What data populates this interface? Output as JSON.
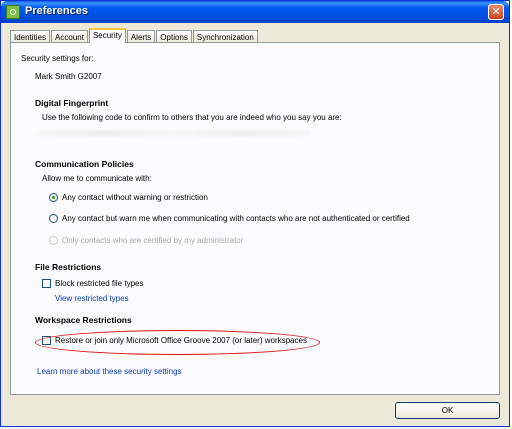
{
  "window": {
    "title": "Preferences",
    "close_glyph": "✕"
  },
  "tabs": [
    {
      "label": "Identities",
      "active": false
    },
    {
      "label": "Account",
      "active": false
    },
    {
      "label": "Security",
      "active": true
    },
    {
      "label": "Alerts",
      "active": false
    },
    {
      "label": "Options",
      "active": false
    },
    {
      "label": "Synchronization",
      "active": false
    }
  ],
  "security": {
    "settings_for_label": "Security settings for:",
    "identity_name": "Mark Smith G2007",
    "fingerprint": {
      "heading": "Digital Fingerprint",
      "description": "Use the following code to confirm to others that you are indeed who you say you are:"
    },
    "communication": {
      "heading": "Communication Policies",
      "allow_label": "Allow me to communicate with:",
      "options": [
        {
          "label": "Any contact without warning or restriction",
          "selected": true,
          "enabled": true
        },
        {
          "label": "Any contact but warn me when communicating with contacts who are not authenticated or certified",
          "selected": false,
          "enabled": true
        },
        {
          "label": "Only contacts who are certified by my administrator",
          "selected": false,
          "enabled": false
        }
      ]
    },
    "file_restrictions": {
      "heading": "File Restrictions",
      "block_label": "Block restricted file types",
      "block_checked": false,
      "view_link": "View restricted types"
    },
    "workspace_restrictions": {
      "heading": "Workspace Restrictions",
      "restore_label": "Restore or join only Microsoft Office Groove 2007 (or later) workspaces",
      "restore_checked": false,
      "highlight_color": "#e01010"
    },
    "learn_more_link": "Learn more about these security settings"
  },
  "footer": {
    "ok_label": "OK"
  },
  "colors": {
    "titlebar": "#0058ee",
    "link": "#0b3bb5",
    "active_tab_accent": "#ffc83c",
    "radio_selected": "#21a121"
  }
}
